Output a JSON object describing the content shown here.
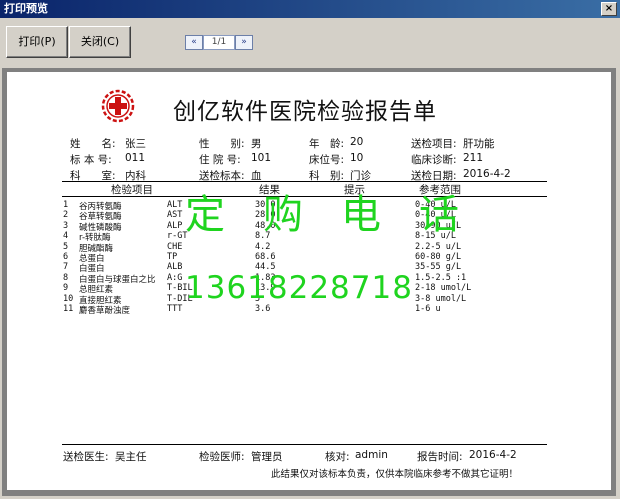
{
  "window": {
    "title": "打印预览",
    "close_glyph": "×"
  },
  "toolbar": {
    "print_label": "打印(P)",
    "close_label": "关闭(C)",
    "prev_glyph": "«",
    "page_indicator": "1/1",
    "next_glyph": "»"
  },
  "report": {
    "title": "创亿软件医院检验报告单",
    "info": {
      "name_label": "姓　　名:",
      "name": "张三",
      "gender_label": "性　　别:",
      "gender": "男",
      "age_label": "年　龄:",
      "age": "20",
      "test_item_label": "送检项目:",
      "test_item": "肝功能",
      "specimen_no_label": "标 本 号:",
      "specimen_no": "011",
      "inpatient_no_label": "住 院 号:",
      "inpatient_no": "101",
      "bed_no_label": "床位号:",
      "bed_no": "10",
      "diagnosis_label": "临床诊断:",
      "diagnosis": "211",
      "dept_label": "科　　室:",
      "dept": "内科",
      "specimen_label": "送检标本:",
      "specimen": "血",
      "ward_label": "科　别:",
      "ward": "门诊",
      "date_label": "送检日期:",
      "date": "2016-4-2"
    },
    "columns": {
      "item": "检验项目",
      "result": "结果",
      "hint": "提示",
      "reference": "参考范围"
    },
    "rows": [
      {
        "no": "1",
        "name": "谷丙转氨酶",
        "code": "ALT",
        "result": "30.0",
        "ref": "0-40 u/L"
      },
      {
        "no": "2",
        "name": "谷草转氨酶",
        "code": "AST",
        "result": "28.0",
        "ref": "0-40 u/L"
      },
      {
        "no": "3",
        "name": "碱性磷酸酶",
        "code": "ALP",
        "result": "48.0",
        "ref": "30-90 u/L"
      },
      {
        "no": "4",
        "name": "r-转肽酶",
        "code": "r-GT",
        "result": "8.7",
        "ref": "8-15 u/L"
      },
      {
        "no": "5",
        "name": "胆碱酯酶",
        "code": "CHE",
        "result": "4.2",
        "ref": "2.2-5 u/L"
      },
      {
        "no": "6",
        "name": "总蛋白",
        "code": "TP",
        "result": "68.6",
        "ref": "60-80 g/L"
      },
      {
        "no": "7",
        "name": "白蛋白",
        "code": "ALB",
        "result": "44.5",
        "ref": "35-55 g/L"
      },
      {
        "no": "8",
        "name": "白蛋白与球蛋白之比",
        "code": "A:G",
        "result": "1.83",
        "ref": "1.5-2.5 :1"
      },
      {
        "no": "9",
        "name": "总胆红素",
        "code": "T-BIL",
        "result": "13.9",
        "ref": "2-18 umol/L"
      },
      {
        "no": "10",
        "name": "直接胆红素",
        "code": "T-DIL",
        "result": "5",
        "ref": "3-8 umol/L"
      },
      {
        "no": "11",
        "name": "麝香草酚浊度",
        "code": "TTT",
        "result": "3.6",
        "ref": "1-6 u"
      }
    ],
    "footer": {
      "doctor_label": "送检医生:",
      "doctor": "吴主任",
      "examiner_label": "检验医师:",
      "examiner": "管理员",
      "checker_label": "核对:",
      "checker": "admin",
      "report_time_label": "报告时间:",
      "report_time": "2016-4-2",
      "disclaimer": "此结果仅对该标本负责，仅供本院临床参考不做其它证明！"
    }
  },
  "watermark": {
    "line1": "定购电话",
    "line2": "13618228718"
  },
  "colors": {
    "logo_red": "#cc1111",
    "watermark_green": "#1fd41f",
    "titlebar": "#0a246a"
  }
}
